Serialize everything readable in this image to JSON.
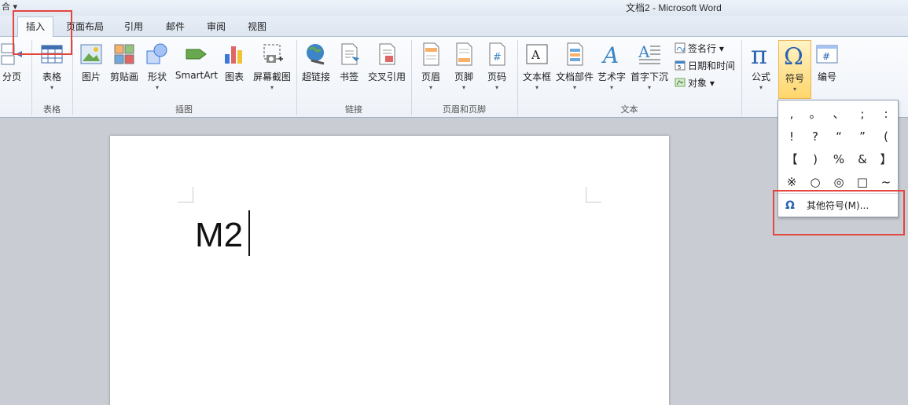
{
  "title_bar": {
    "quick_access": "合 ▾",
    "title": "文档2 - Microsoft Word"
  },
  "tabs": [
    {
      "label": "插入",
      "active": true
    },
    {
      "label": "页面布局"
    },
    {
      "label": "引用"
    },
    {
      "label": "邮件"
    },
    {
      "label": "审阅"
    },
    {
      "label": "视图"
    }
  ],
  "ribbon": {
    "pages_group": {
      "page_break": "分页"
    },
    "table_group": {
      "label": "表格",
      "table": "表格"
    },
    "illustrations_group": {
      "label": "插图",
      "picture": "图片",
      "clipart": "剪贴画",
      "shapes": "形状",
      "smartart": "SmartArt",
      "chart": "图表",
      "screenshot": "屏幕截图"
    },
    "links_group": {
      "label": "链接",
      "hyperlink": "超链接",
      "bookmark": "书签",
      "crossref": "交叉引用"
    },
    "header_footer_group": {
      "label": "页眉和页脚",
      "header": "页眉",
      "footer": "页脚",
      "page_number": "页码"
    },
    "text_group": {
      "label": "文本",
      "textbox": "文本框",
      "quickparts": "文档部件",
      "wordart": "艺术字",
      "dropcap": "首字下沉",
      "signature_line": "签名行 ▾",
      "date_time": "日期和时间",
      "object": "对象 ▾"
    },
    "symbols_group": {
      "equation": "公式",
      "symbol": "符号",
      "numbering": "编号"
    }
  },
  "document": {
    "text": "M2"
  },
  "symbol_dropdown": {
    "symbols": [
      ",",
      "。",
      "、",
      ";",
      ":",
      "!",
      "?",
      "“",
      "”",
      "(",
      "【",
      ")",
      "%",
      "&",
      "】",
      "※",
      "○",
      "◎",
      "□",
      "~"
    ],
    "more_symbols": "其他符号(M)..."
  },
  "colors": {
    "highlight_red": "#e4453d",
    "active_button": "#ffd66b"
  }
}
